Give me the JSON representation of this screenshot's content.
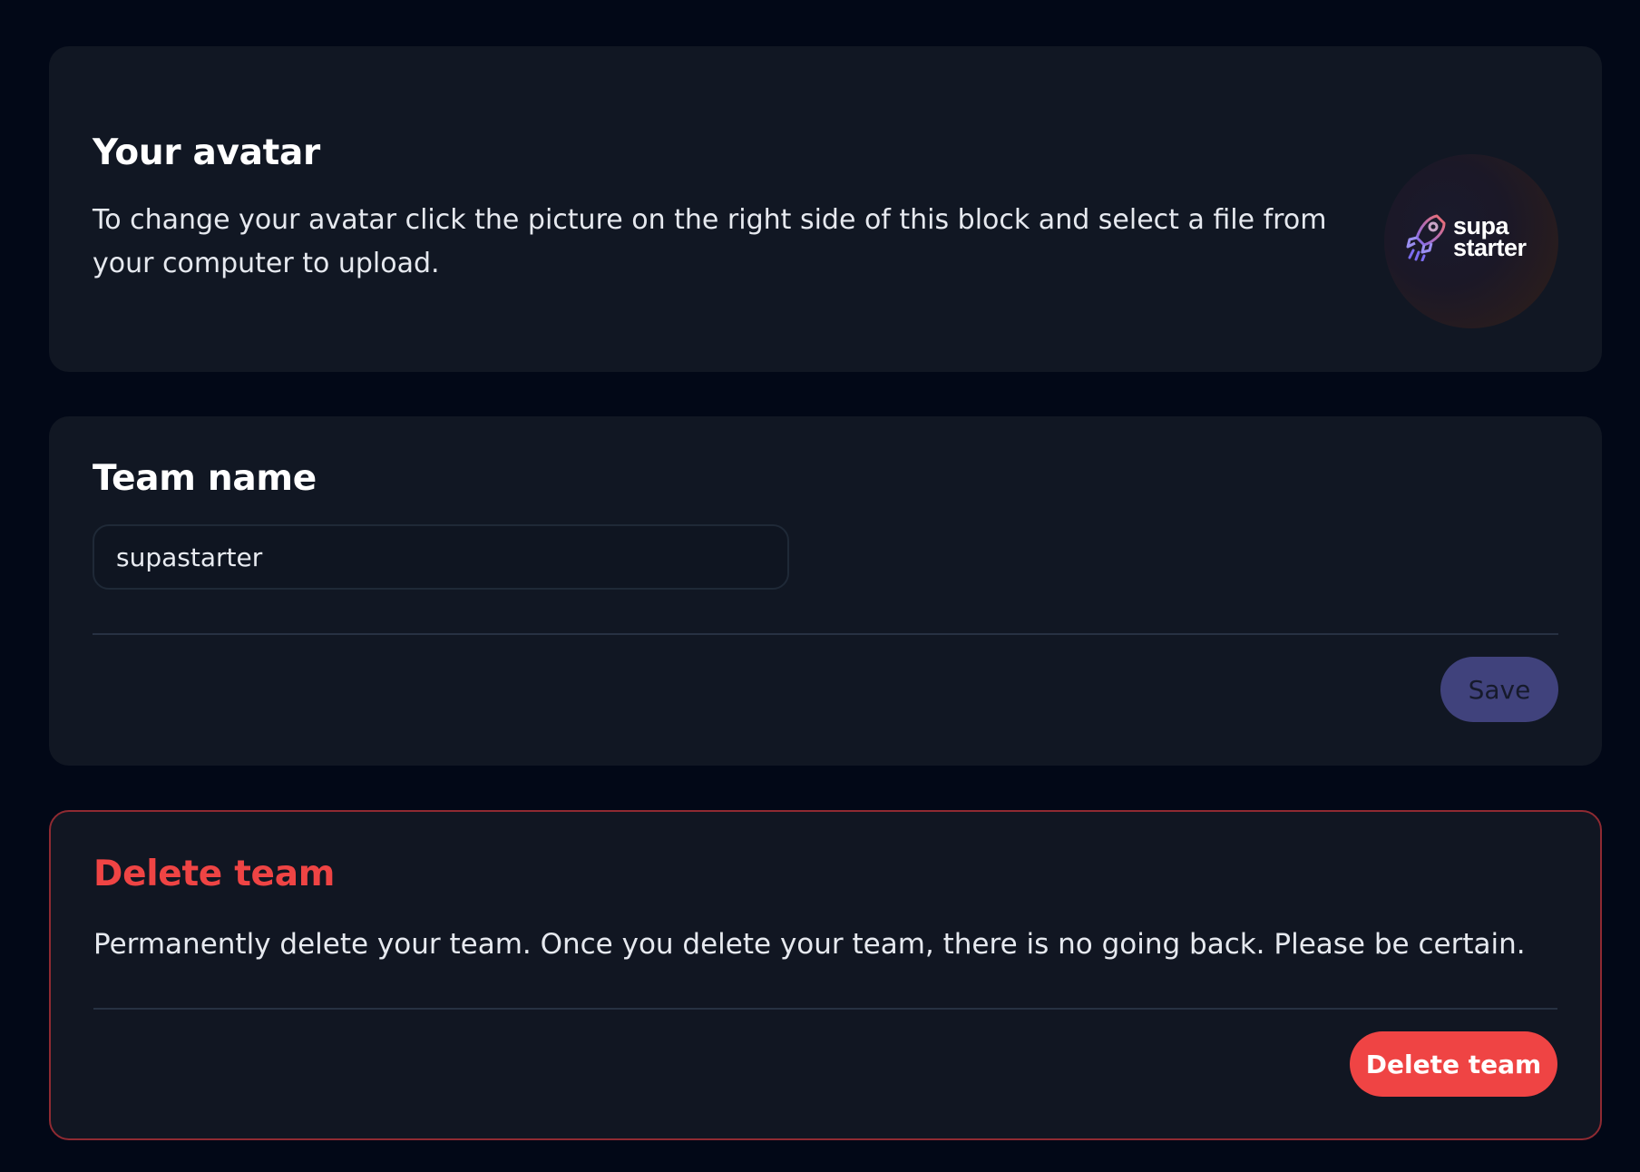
{
  "avatar_section": {
    "title": "Your avatar",
    "description": "To change your avatar click the picture on the right side of this block and select a file from your computer to upload.",
    "logo_line1": "supa",
    "logo_line2": "starter"
  },
  "team_section": {
    "title": "Team name",
    "input_value": "supastarter",
    "save_label": "Save"
  },
  "danger_section": {
    "title": "Delete team",
    "description": "Permanently delete your team. Once you delete your team, there is no going back. Please be certain.",
    "delete_label": "Delete team"
  },
  "colors": {
    "background": "#020817",
    "card": "#111723",
    "danger": "#ef4444",
    "primary_muted": "#40427c"
  }
}
